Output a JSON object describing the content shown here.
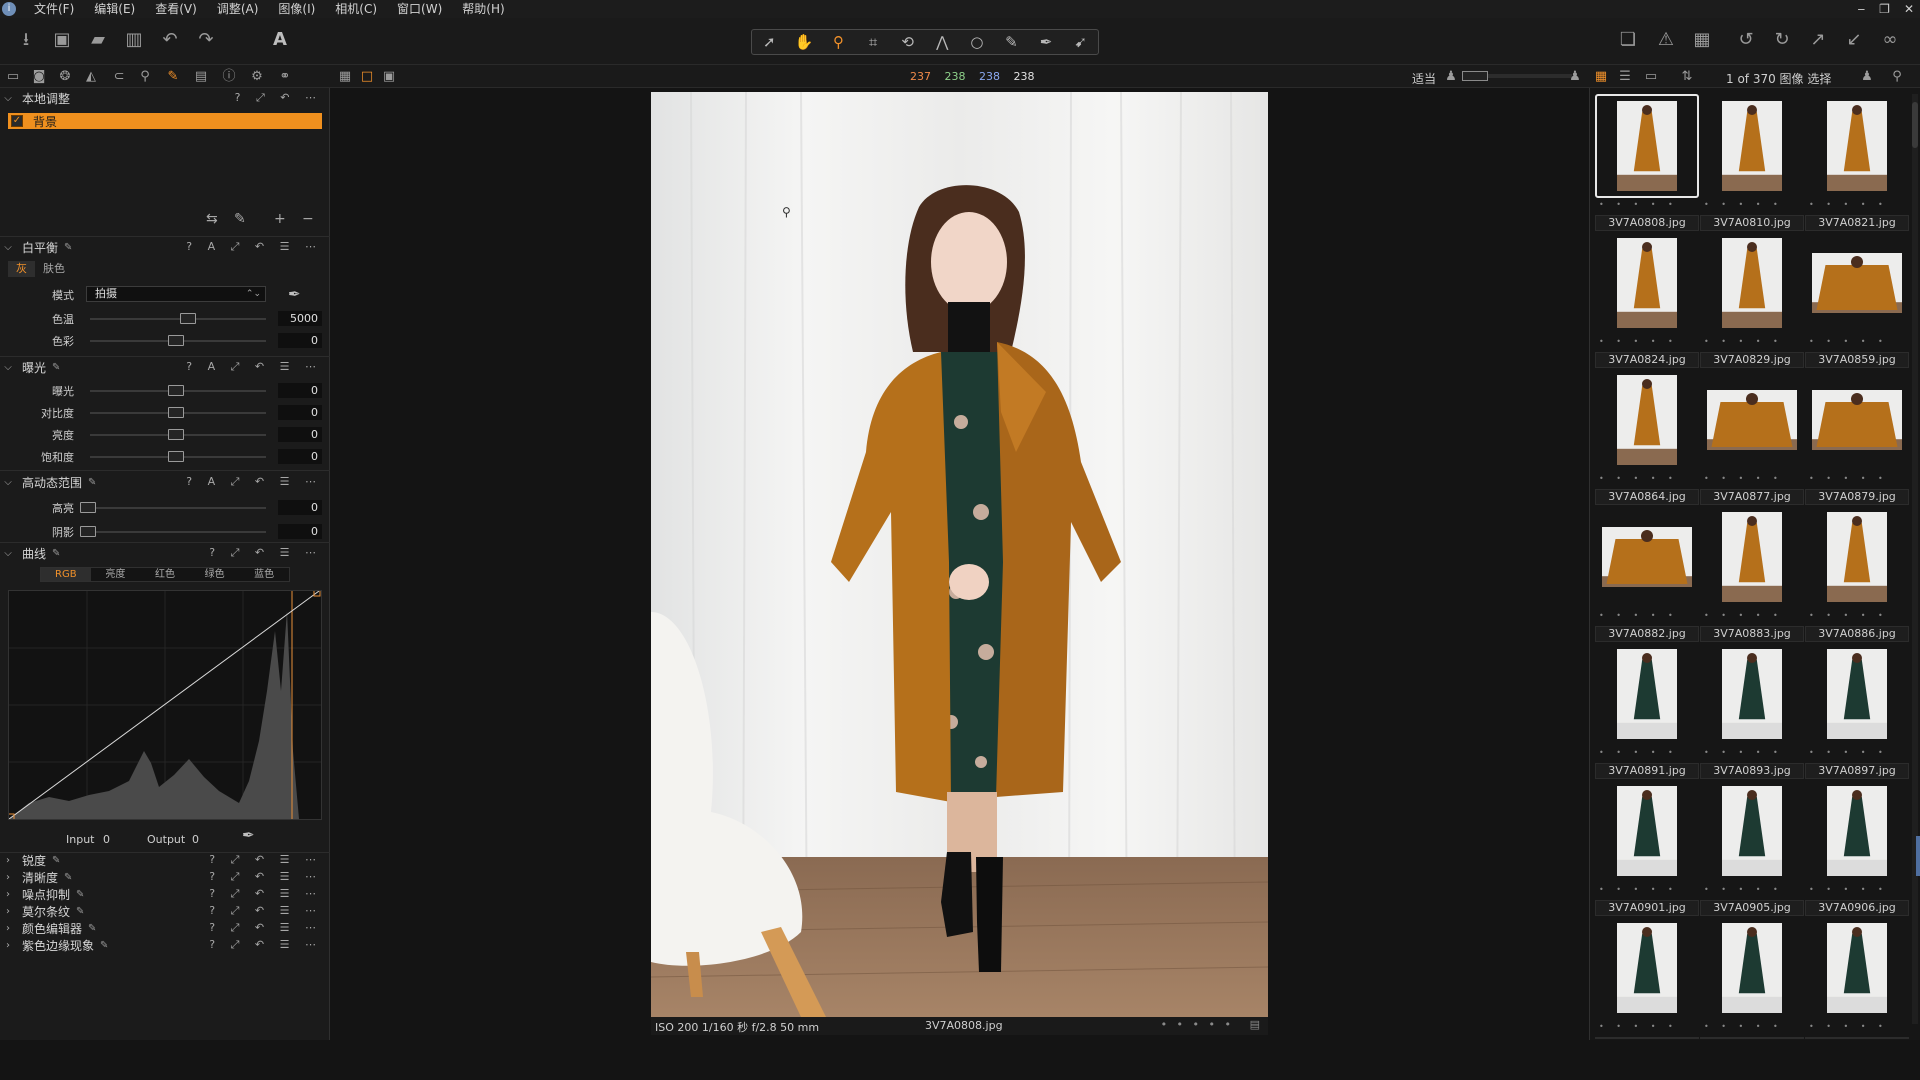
{
  "menubar": {
    "items": [
      "文件(F)",
      "编辑(E)",
      "查看(V)",
      "调整(A)",
      "图像(I)",
      "相机(C)",
      "窗口(W)",
      "帮助(H)"
    ],
    "window_controls": [
      "‒",
      "❐",
      "✕"
    ]
  },
  "viewer_toolbar": {
    "rgb": {
      "r": "237",
      "g": "238",
      "b": "238",
      "l": "238"
    },
    "zoom_label": "适当"
  },
  "browser_header": {
    "count": "1 of 370 图像 选择"
  },
  "left_panel": {
    "local_adjust": {
      "title": "本地调整",
      "layer": "背景"
    },
    "white_balance": {
      "title": "白平衡",
      "tabs": [
        "灰",
        "肤色"
      ],
      "mode_label": "模式",
      "mode_value": "拍摄",
      "temp_label": "色温",
      "temp_value": "5000",
      "tint_label": "色彩",
      "tint_value": "0"
    },
    "exposure": {
      "title": "曝光",
      "rows": [
        {
          "label": "曝光",
          "value": "0"
        },
        {
          "label": "对比度",
          "value": "0"
        },
        {
          "label": "亮度",
          "value": "0"
        },
        {
          "label": "饱和度",
          "value": "0"
        }
      ]
    },
    "hdr": {
      "title": "高动态范围",
      "rows": [
        {
          "label": "高亮",
          "value": "0"
        },
        {
          "label": "阴影",
          "value": "0"
        }
      ]
    },
    "curve": {
      "title": "曲线",
      "tabs": [
        "RGB",
        "亮度",
        "红色",
        "绿色",
        "蓝色"
      ],
      "input_label": "Input",
      "input_value": "0",
      "output_label": "Output",
      "output_value": "0"
    },
    "collapsed_sections": [
      "锐度",
      "清晰度",
      "噪点抑制",
      "莫尔条纹",
      "颜色编辑器",
      "紫色边缘现象"
    ]
  },
  "photo": {
    "exif": "ISO 200  1/160 秒  f/2.8  50 mm",
    "filename": "3V7A0808.jpg",
    "stars": "• • • • •"
  },
  "thumbnails": [
    {
      "name": "3V7A0808.jpg",
      "kind": "tall",
      "selected": true
    },
    {
      "name": "3V7A0810.jpg",
      "kind": "tall"
    },
    {
      "name": "3V7A0821.jpg",
      "kind": "tall"
    },
    {
      "name": "3V7A0824.jpg",
      "kind": "tall"
    },
    {
      "name": "3V7A0829.jpg",
      "kind": "tall"
    },
    {
      "name": "3V7A0859.jpg",
      "kind": "wide"
    },
    {
      "name": "3V7A0864.jpg",
      "kind": "tall"
    },
    {
      "name": "3V7A0877.jpg",
      "kind": "wide"
    },
    {
      "name": "3V7A0879.jpg",
      "kind": "wide"
    },
    {
      "name": "3V7A0882.jpg",
      "kind": "wide"
    },
    {
      "name": "3V7A0883.jpg",
      "kind": "tall"
    },
    {
      "name": "3V7A0886.jpg",
      "kind": "tall"
    },
    {
      "name": "3V7A0891.jpg",
      "kind": "tall-green"
    },
    {
      "name": "3V7A0893.jpg",
      "kind": "tall-green"
    },
    {
      "name": "3V7A0897.jpg",
      "kind": "tall-green"
    },
    {
      "name": "3V7A0901.jpg",
      "kind": "tall-green"
    },
    {
      "name": "3V7A0905.jpg",
      "kind": "tall-green"
    },
    {
      "name": "3V7A0906.jpg",
      "kind": "tall-green"
    },
    {
      "name": "",
      "kind": "tall-green"
    },
    {
      "name": "",
      "kind": "tall-green"
    },
    {
      "name": "",
      "kind": "tall-green"
    }
  ],
  "colors": {
    "accent": "#f0902a",
    "coat": "#b5701b",
    "dress": "#1d3a32",
    "curtain": "#ededec",
    "floor": "#8a6a50"
  }
}
